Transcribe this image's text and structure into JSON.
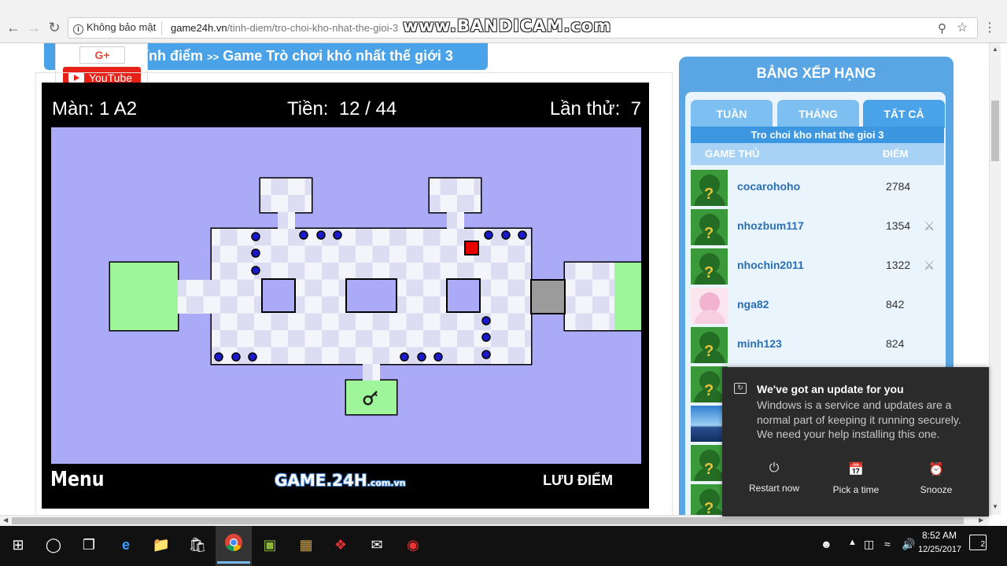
{
  "browser": {
    "security_label": "Không bảo mật",
    "url_host": "game24h.vn",
    "url_path": "/tinh-diem/tro-choi-kho-nhat-the-gioi-3",
    "watermark": "www.BANDICAM.com"
  },
  "share": {
    "gplus_label": "G+",
    "youtube_label": "YouTube"
  },
  "breadcrumb": {
    "part1": "ính điểm",
    "separator": ">>",
    "part2": "Game Trò chơi khó nhất thế giới 3"
  },
  "game": {
    "level_label": "Màn: 1 A2",
    "coins_label": "Tiền:",
    "coins_value": "12 / 44",
    "tries_label": "Lần thử:",
    "tries_value": "7",
    "menu_label": "Menu",
    "logo_main": "GAME.24H",
    "logo_suffix": ".com.vn",
    "save_label": "LƯU ĐIỂM",
    "colors": {
      "background": "#aaaaf7",
      "safe_zone": "#9ef59a",
      "tile_light": "#f4f4fb",
      "tile_dark": "#dcdcf2",
      "enemy": "#1a1acc",
      "player": "#e80000",
      "gate": "#9b9b9b"
    }
  },
  "leaderboard": {
    "title": "BẢNG XẾP HẠNG",
    "tabs": [
      "TUẦN",
      "THÁNG",
      "TẤT CẢ"
    ],
    "active_tab": "TẤT CẢ",
    "game_name": "Tro choi kho nhat the gioi 3",
    "col_player": "GAME THỦ",
    "col_score": "ĐIỂM",
    "rows": [
      {
        "name": "cocarohoho",
        "score": "2784",
        "badge": ""
      },
      {
        "name": "nhozbum117",
        "score": "1354",
        "badge": "swords-icon"
      },
      {
        "name": "nhochin2011",
        "score": "1322",
        "badge": "swords-icon"
      },
      {
        "name": "nga82",
        "score": "842",
        "badge": ""
      },
      {
        "name": "minh123",
        "score": "824",
        "badge": ""
      }
    ]
  },
  "toast": {
    "title": "We've got an update for you",
    "body": "Windows is a service and updates are a normal part of keeping it running securely. We need your help installing this one.",
    "actions": [
      "Restart now",
      "Pick a time",
      "Snooze"
    ]
  },
  "taskbar": {
    "time": "8:52 AM",
    "date": "12/25/2017",
    "notification_count": "2"
  }
}
